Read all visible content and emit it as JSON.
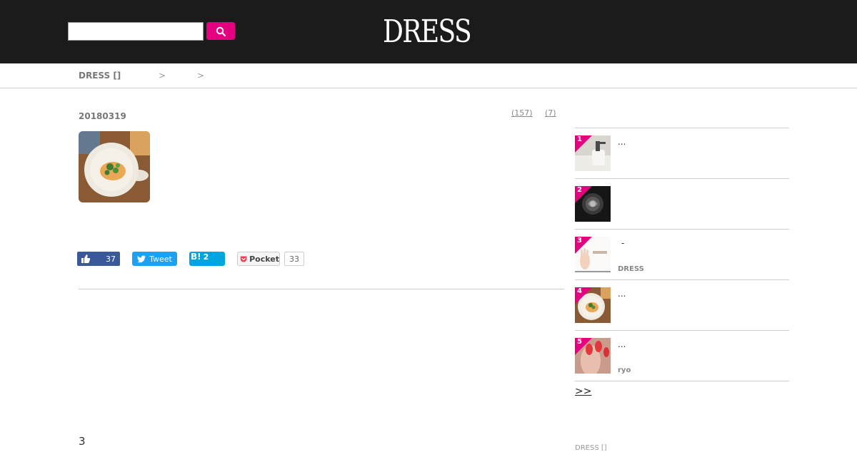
{
  "header": {
    "logo": "DRESS",
    "search": {
      "value": "",
      "placeholder": ""
    }
  },
  "breadcrumb": {
    "home": "DRESS []",
    "separators": [
      ">",
      ">"
    ]
  },
  "article": {
    "date": "20180319",
    "counts": [
      "(157)",
      "(7)"
    ],
    "section_number": "3"
  },
  "social": {
    "facebook_count": "37",
    "tweet_label": "Tweet",
    "hatena_label": "B!",
    "hatena_count": "2",
    "pocket_label": "Pocket",
    "pocket_count": "33"
  },
  "ranking": {
    "items": [
      {
        "rank": "1",
        "title": "...",
        "author": ""
      },
      {
        "rank": "2",
        "title": "",
        "author": ""
      },
      {
        "rank": "3",
        "title": "-",
        "author": "DRESS"
      },
      {
        "rank": "4",
        "title": "...",
        "author": ""
      },
      {
        "rank": "5",
        "title": "...",
        "author": "ryo"
      }
    ],
    "more_label": ">>"
  },
  "footer": {
    "breadcrumb": "DRESS []"
  },
  "colors": {
    "accent": "#e4007f",
    "header_bg": "#1b1b1b",
    "facebook": "#3b5998",
    "twitter": "#1da1f2",
    "hatena": "#00a4de"
  }
}
